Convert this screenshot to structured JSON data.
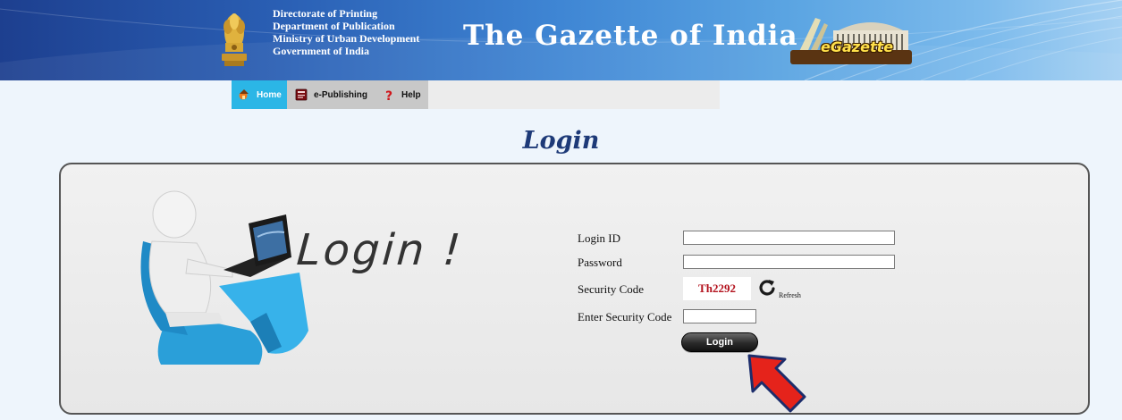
{
  "header": {
    "org_lines": [
      "Directorate of Printing",
      "Department of Publication",
      "Ministry of Urban Development",
      "Government of India"
    ],
    "title": "The Gazette of India",
    "logo_text": "eGazette"
  },
  "nav": {
    "items": [
      {
        "label": "Home",
        "icon": "home-icon",
        "active": true
      },
      {
        "label": "e-Publishing",
        "icon": "book-icon",
        "active": false
      },
      {
        "label": "Help",
        "icon": "question-icon",
        "active": false
      }
    ]
  },
  "page": {
    "title": "Login",
    "illustration_text": "Login !"
  },
  "form": {
    "login_id_label": "Login ID",
    "login_id_value": "",
    "password_label": "Password",
    "password_value": "",
    "security_code_label": "Security Code",
    "captcha_text": "Th2292",
    "refresh_label": "Refresh",
    "enter_code_label": "Enter Security Code",
    "enter_code_value": "",
    "submit_label": "Login"
  },
  "colors": {
    "banner_dark": "#1d3f8f",
    "banner_light": "#a6d1f3",
    "nav_active": "#2bb6e6",
    "heading": "#1e3a78",
    "captcha_text": "#b3121d",
    "arrow": "#e5231b"
  }
}
